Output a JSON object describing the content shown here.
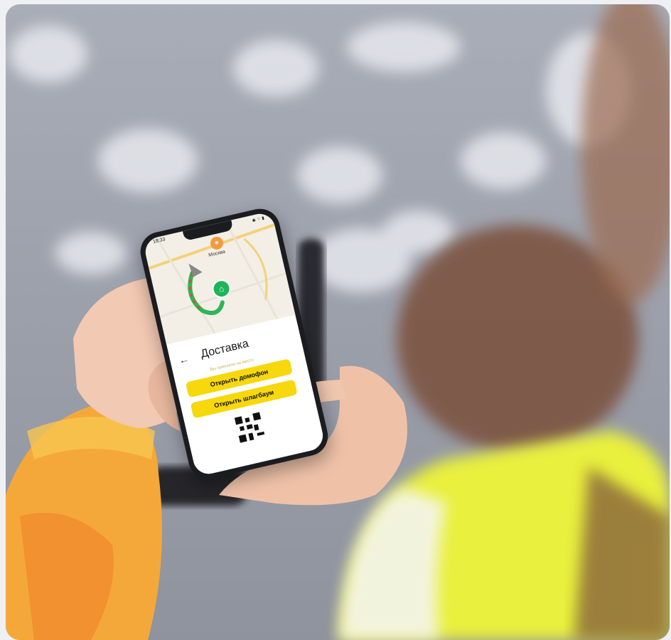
{
  "phone": {
    "time": "18:33",
    "map_city": "Москва",
    "title": "Доставка",
    "hint": "Вы приехали на место",
    "open_intercom": "Открыть домофон",
    "open_barrier": "Открыть шлагбаум",
    "back_icon": "arrow-left-icon",
    "qr_icon": "qr-code-icon"
  },
  "colors": {
    "accent": "#f6d80c",
    "map_green": "#1fb45a",
    "jacket": "#f5b23c",
    "vest": "#e8ef3a"
  }
}
